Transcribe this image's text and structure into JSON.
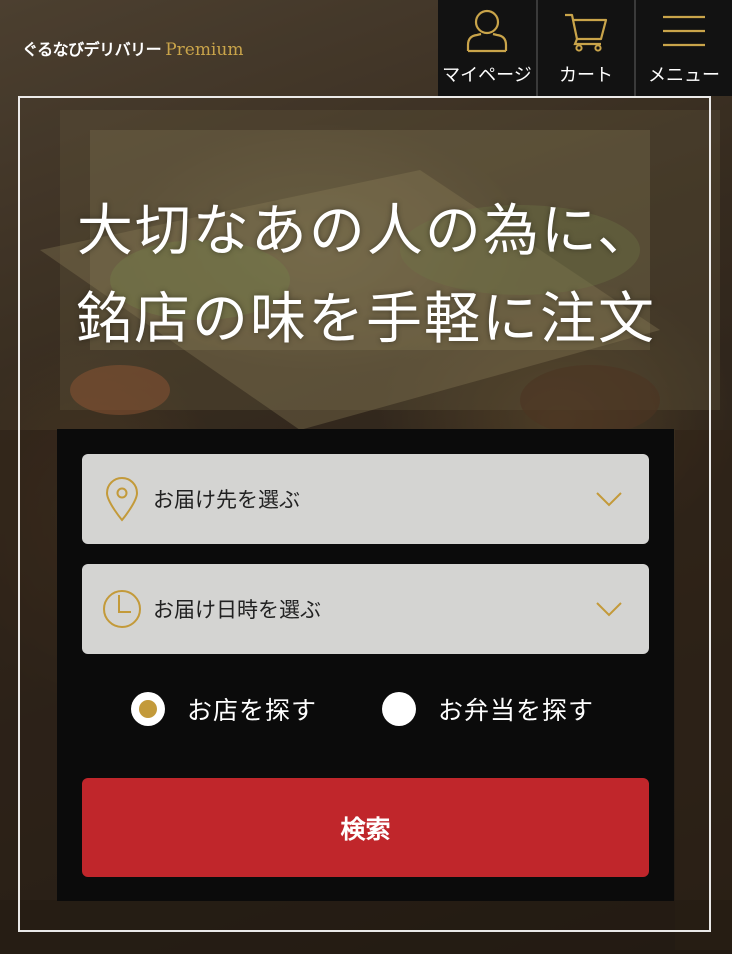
{
  "header": {
    "logo_main": "ぐるなびデリバリー",
    "logo_sub": "Premium",
    "nav": [
      {
        "label": "マイページ",
        "icon": "user-icon"
      },
      {
        "label": "カート",
        "icon": "cart-icon"
      },
      {
        "label": "メニュー",
        "icon": "hamburger-menu-icon"
      }
    ]
  },
  "hero": {
    "line1": "大切なあの人の為に、",
    "line2": "銘店の味を手軽に注文"
  },
  "search_form": {
    "address_select": {
      "label": "お届け先を選ぶ",
      "icon": "location-pin-icon"
    },
    "datetime_select": {
      "label": "お届け日時を選ぶ",
      "icon": "clock-icon"
    },
    "radio_options": [
      {
        "label": "お店を探す",
        "selected": true
      },
      {
        "label": "お弁当を探す",
        "selected": false
      }
    ],
    "submit_label": "検索"
  },
  "colors": {
    "accent_gold": "#c9a44a",
    "search_red": "#c0262b",
    "panel_black": "#0b0b0b",
    "select_gray": "#d4d4d2"
  }
}
